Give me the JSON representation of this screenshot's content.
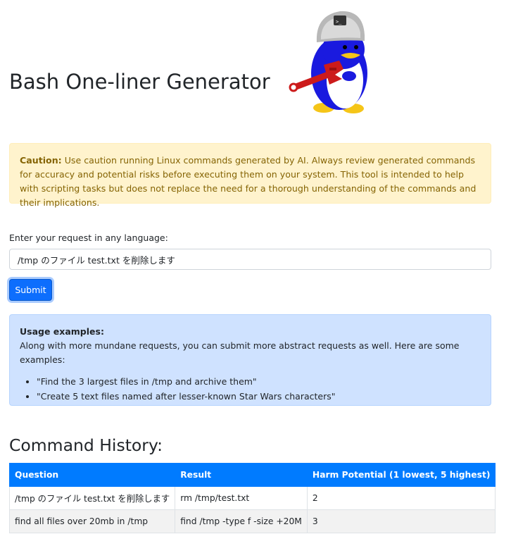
{
  "page": {
    "title": "Bash One-liner Generator"
  },
  "caution": {
    "label": "Caution:",
    "text": " Use caution running Linux commands generated by AI. Always review generated commands for accuracy and potential risks before executing them on your system. This tool is intended to help with scripting tasks but does not replace the need for a thorough understanding of the commands and their implications."
  },
  "form": {
    "label": "Enter your request in any language:",
    "input_value": "/tmp のファイル test.txt を削除します",
    "submit_label": "Submit"
  },
  "usage": {
    "heading": "Usage examples:",
    "intro": "Along with more mundane requests, you can submit more abstract requests as well. Here are some examples:",
    "examples": [
      "\"Find the 3 largest files in /tmp and archive them\"",
      "\"Create 5 text files named after lesser-known Star Wars characters\""
    ]
  },
  "history": {
    "title": "Command History:",
    "columns": [
      "Question",
      "Result",
      "Harm Potential (1 lowest, 5 highest)"
    ],
    "rows": [
      {
        "question": "/tmp のファイル test.txt を削除します",
        "result": "rm /tmp/test.txt",
        "harm": "2"
      },
      {
        "question": "find all files over 20mb in /tmp",
        "result": "find /tmp -type f -size +20M",
        "harm": "3"
      }
    ]
  },
  "colors": {
    "accent": "#0d6efd",
    "table_header": "#007bff",
    "warning_bg": "#fff3cd",
    "info_bg": "#cfe2ff"
  },
  "icons": {
    "mascot": "penguin-mascot-icon"
  }
}
